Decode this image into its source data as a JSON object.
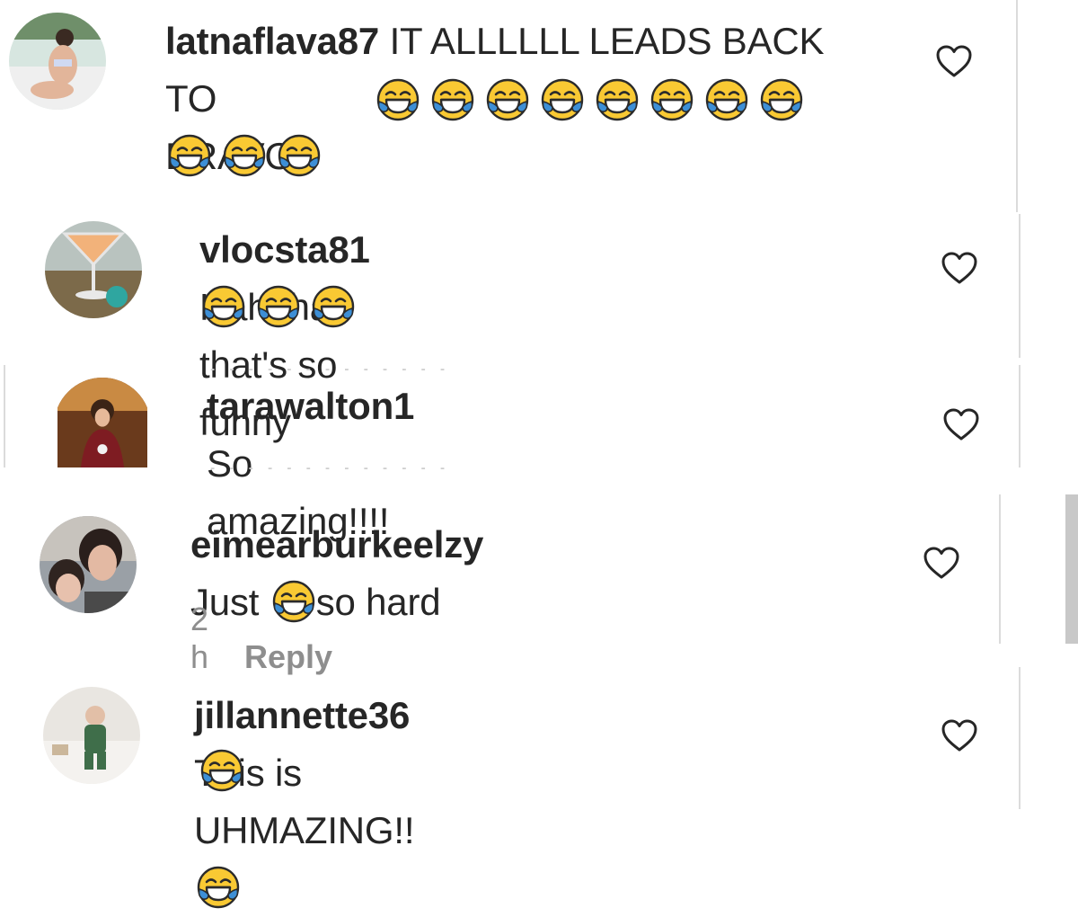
{
  "comments": [
    {
      "username": "latnaflava87",
      "text_line1": "IT ALLLLLL LEADS BACK",
      "text_line2": "TO BRAVO",
      "emoji_row1_count": 8,
      "emoji_row2_count": 3,
      "avatar": "woman-in-bikini-poolside"
    },
    {
      "username": "vlocsta81",
      "text": "Hahaha, that's so funny",
      "emoji_count": 3,
      "avatar": "cocktail-glass"
    },
    {
      "username": "tarawalton1",
      "text": "So amazing!!!!",
      "avatar": "woman-indoors-warm"
    },
    {
      "username": "eimearburkeelzy",
      "text_before": "Just",
      "text_after": "so hard",
      "time": "2 h",
      "reply_label": "Reply",
      "avatar": "woman-and-child"
    },
    {
      "username": "jillannette36",
      "text": "This is UHMAZING!!",
      "avatar": "baby-in-pajamas"
    }
  ],
  "icons": {
    "emoji": "face-with-tears-of-joy-icon",
    "like": "heart-outline-icon"
  },
  "colors": {
    "text": "#262626",
    "meta": "#8e8e8e",
    "divider": "#dbdbdb",
    "emoji_face": "#f9c933",
    "emoji_tears": "#3d8fd6"
  }
}
